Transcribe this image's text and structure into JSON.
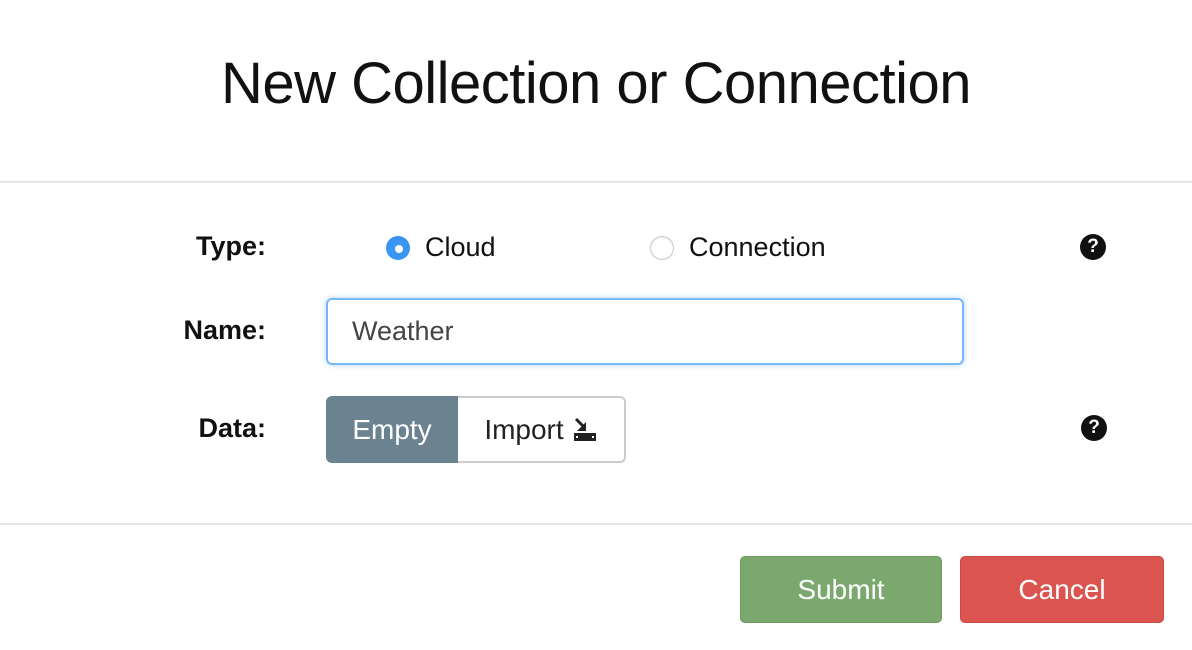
{
  "dialog": {
    "title": "New Collection or Connection"
  },
  "form": {
    "type": {
      "label": "Type:",
      "options": [
        {
          "label": "Cloud",
          "selected": true
        },
        {
          "label": "Connection",
          "selected": false
        }
      ],
      "help_glyph": "?"
    },
    "name": {
      "label": "Name:",
      "value": "Weather"
    },
    "data": {
      "label": "Data:",
      "options": [
        {
          "label": "Empty",
          "active": true
        },
        {
          "label": "Import",
          "active": false,
          "icon": "import-icon"
        }
      ],
      "help_glyph": "?"
    }
  },
  "footer": {
    "submit_label": "Submit",
    "cancel_label": "Cancel"
  },
  "colors": {
    "radio_selected": "#3b96f3",
    "segment_active": "#6b8390",
    "submit": "#7ba86e",
    "cancel": "#dc5450",
    "input_focus": "#7ab8f5"
  }
}
